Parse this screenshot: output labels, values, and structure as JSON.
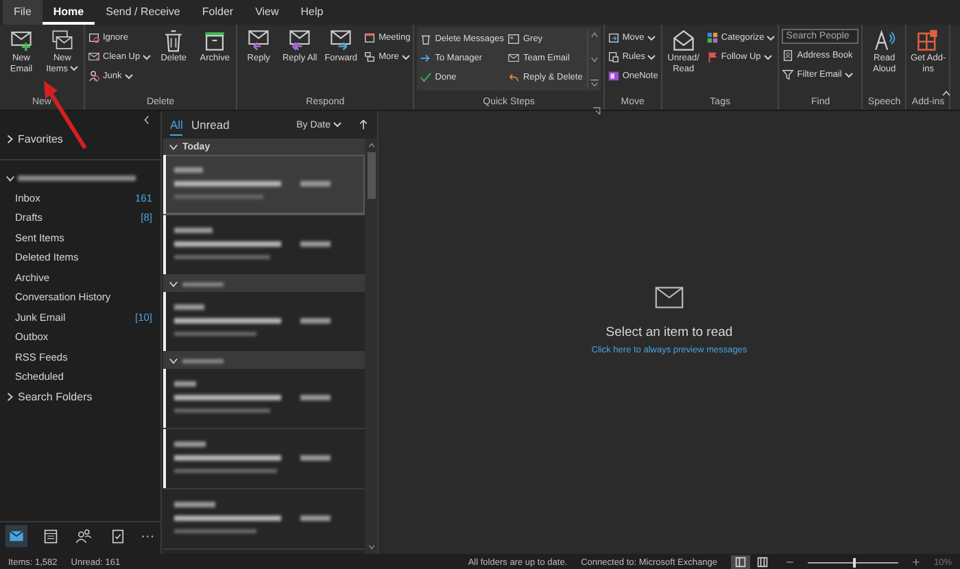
{
  "menu_tabs": [
    {
      "label": "File",
      "selected": false
    },
    {
      "label": "Home",
      "selected": true
    },
    {
      "label": "Send / Receive",
      "selected": false
    },
    {
      "label": "Folder",
      "selected": false
    },
    {
      "label": "View",
      "selected": false
    },
    {
      "label": "Help",
      "selected": false
    }
  ],
  "ribbon": {
    "groups": [
      {
        "label": "New",
        "columns": [
          {
            "kind": "large",
            "label": "New Email",
            "dropdown": false
          },
          {
            "kind": "large",
            "label": "New Items",
            "dropdown": true
          }
        ]
      },
      {
        "label": "Delete",
        "columns": [
          {
            "kind": "stack",
            "items": [
              {
                "label": "Ignore",
                "dropdown": false
              },
              {
                "label": "Clean Up",
                "dropdown": true
              },
              {
                "label": "Junk",
                "dropdown": true
              }
            ]
          },
          {
            "kind": "large",
            "label": "Delete",
            "dropdown": false
          },
          {
            "kind": "large",
            "label": "Archive",
            "dropdown": false
          }
        ]
      },
      {
        "label": "Respond",
        "columns": [
          {
            "kind": "large",
            "label": "Reply",
            "dropdown": false
          },
          {
            "kind": "large",
            "label": "Reply All",
            "dropdown": false
          },
          {
            "kind": "large",
            "label": "Forward",
            "dropdown": false
          },
          {
            "kind": "stack",
            "items": [
              {
                "label": "Meeting",
                "dropdown": false
              },
              {
                "label": "More",
                "dropdown": true
              }
            ]
          }
        ]
      },
      {
        "label": "Quick Steps",
        "launcher": true,
        "columns": [
          {
            "kind": "gallery",
            "items": [
              {
                "label": "Delete Messages"
              },
              {
                "label": "To Manager"
              },
              {
                "label": "Done"
              },
              {
                "label": "Grey"
              },
              {
                "label": "Team Email"
              },
              {
                "label": "Reply & Delete"
              }
            ]
          }
        ]
      },
      {
        "label": "Move",
        "columns": [
          {
            "kind": "stack",
            "items": [
              {
                "label": "Move",
                "dropdown": true
              },
              {
                "label": "Rules",
                "dropdown": true
              },
              {
                "label": "OneNote",
                "dropdown": false
              }
            ]
          }
        ]
      },
      {
        "label": "Tags",
        "columns": [
          {
            "kind": "large",
            "label": "Unread/ Read",
            "dropdown": false
          },
          {
            "kind": "stack",
            "items": [
              {
                "label": "Categorize",
                "dropdown": true
              },
              {
                "label": "Follow Up",
                "dropdown": true
              }
            ]
          }
        ]
      },
      {
        "label": "Find",
        "columns": [
          {
            "kind": "search",
            "placeholder": "Search People",
            "items": [
              {
                "label": "Address Book",
                "dropdown": false
              },
              {
                "label": "Filter Email",
                "dropdown": true
              }
            ]
          }
        ]
      },
      {
        "label": "Speech",
        "columns": [
          {
            "kind": "large",
            "label": "Read Aloud",
            "dropdown": false
          }
        ]
      },
      {
        "label": "Add-ins",
        "columns": [
          {
            "kind": "large",
            "label": "Get Add-ins",
            "dropdown": false
          }
        ]
      }
    ]
  },
  "folder_pane": {
    "favorites": {
      "label": "Favorites",
      "expanded": false
    },
    "account": {
      "expanded": true,
      "folders": [
        {
          "label": "Inbox",
          "count": "161"
        },
        {
          "label": "Drafts",
          "count": "[8]"
        },
        {
          "label": "Sent Items"
        },
        {
          "label": "Deleted Items"
        },
        {
          "label": "Archive"
        },
        {
          "label": "Conversation History"
        },
        {
          "label": "Junk Email",
          "count": "[10]"
        },
        {
          "label": "Outbox"
        },
        {
          "label": "RSS Feeds"
        },
        {
          "label": "Scheduled"
        }
      ]
    },
    "search_folders": {
      "label": "Search Folders",
      "expanded": false
    },
    "nav": [
      {
        "selected": true
      },
      {
        "selected": false
      },
      {
        "selected": false
      },
      {
        "selected": false
      }
    ],
    "nav_more": "···"
  },
  "mail_list": {
    "filters": [
      {
        "label": "All",
        "selected": true
      },
      {
        "label": "Unread",
        "selected": false
      }
    ],
    "sort": "By Date",
    "entries": [
      {
        "kind": "header",
        "label": "Today"
      },
      {
        "kind": "message",
        "selected": true,
        "unread": true
      },
      {
        "kind": "message",
        "selected": false,
        "unread": true
      },
      {
        "kind": "header"
      },
      {
        "kind": "message",
        "selected": false,
        "unread": true
      },
      {
        "kind": "header"
      },
      {
        "kind": "message",
        "selected": false,
        "unread": true
      },
      {
        "kind": "message",
        "selected": false,
        "unread": true
      },
      {
        "kind": "message",
        "selected": false,
        "unread": false
      }
    ]
  },
  "reading_pane": {
    "title": "Select an item to read",
    "link": "Click here to always preview messages"
  },
  "status_bar": {
    "items": "Items: 1,582",
    "unread": "Unread: 161",
    "sync": "All folders are up to date.",
    "connection": "Connected to: Microsoft Exchange",
    "views": [
      {
        "selected": true
      },
      {
        "selected": false
      }
    ],
    "zoom": {
      "level": 0.5,
      "reading": "10%"
    }
  }
}
